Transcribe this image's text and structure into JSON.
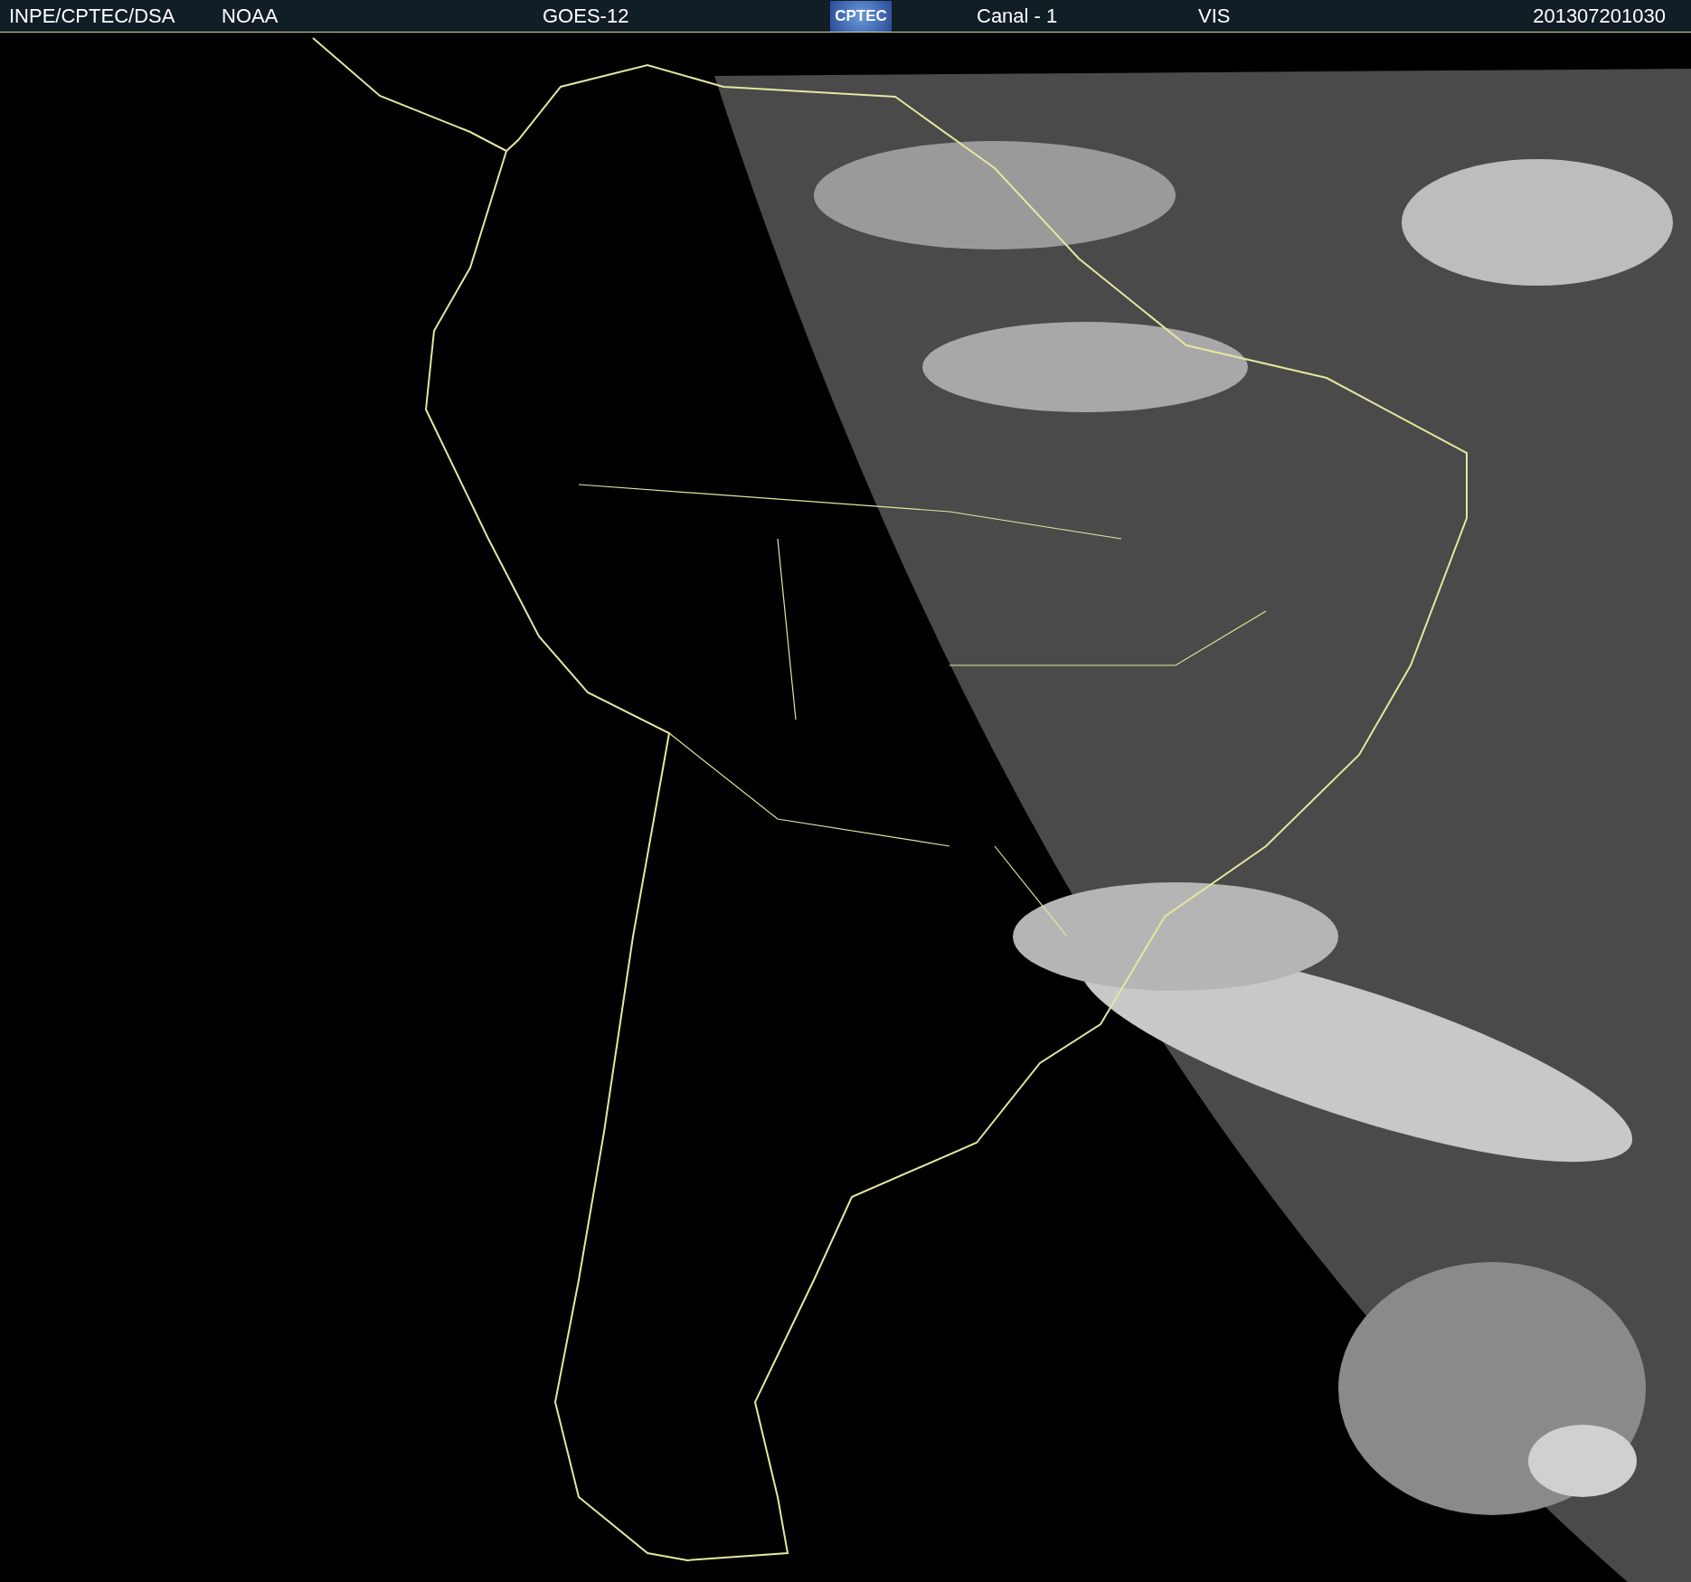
{
  "header": {
    "agency": "INPE/CPTEC/DSA",
    "source": "NOAA",
    "satellite": "GOES-12",
    "logo": "CPTEC",
    "channel": "Canal - 1",
    "band": "VIS",
    "timestamp": "201307201030"
  }
}
